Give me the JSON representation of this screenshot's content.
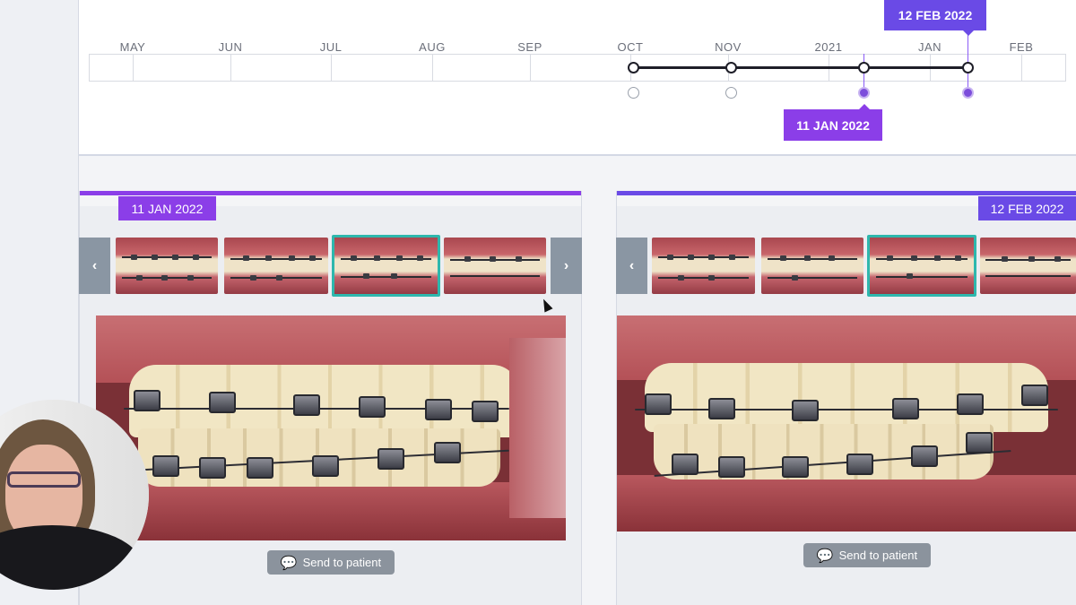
{
  "timeline": {
    "months": [
      "MAY",
      "JUN",
      "JUL",
      "AUG",
      "SEP",
      "OCT",
      "NOV",
      "2021",
      "JAN",
      "FEB"
    ],
    "active_tag_top": "12 FEB 2022",
    "active_tag_bottom": "11 JAN 2022"
  },
  "panels": [
    {
      "date_label": "11 JAN 2022",
      "accent": "#8b3ee8",
      "send_label": "Send to patient",
      "prev_icon": "‹",
      "next_icon": "›"
    },
    {
      "date_label": "12 FEB 2022",
      "accent": "#6a4ae6",
      "send_label": "Send to patient",
      "prev_icon": "‹"
    }
  ],
  "colors": {
    "selected_thumb": "#2eb7ad",
    "timeline_line": "#1e1e28"
  }
}
